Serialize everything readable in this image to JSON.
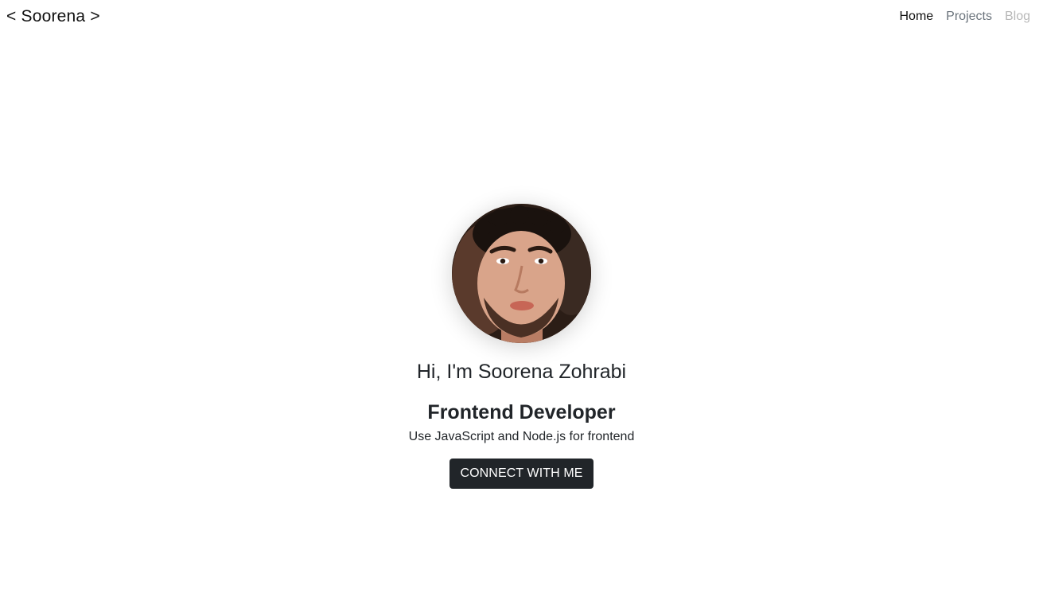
{
  "header": {
    "brand": "< Soorena >",
    "nav": [
      {
        "label": "Home",
        "state": "active"
      },
      {
        "label": "Projects",
        "state": "normal"
      },
      {
        "label": "Blog",
        "state": "muted"
      }
    ]
  },
  "hero": {
    "avatar_icon": "profile-photo",
    "greeting": "Hi, I'm Soorena Zohrabi",
    "role": "Frontend Developer",
    "tagline": "Use JavaScript and Node.js for frontend",
    "cta_label": "CONNECT WITH ME"
  },
  "colors": {
    "text": "#212529",
    "button_bg": "#212529",
    "button_text": "#ffffff",
    "nav_inactive": "#6c757d",
    "nav_muted": "#b8b8b8"
  }
}
